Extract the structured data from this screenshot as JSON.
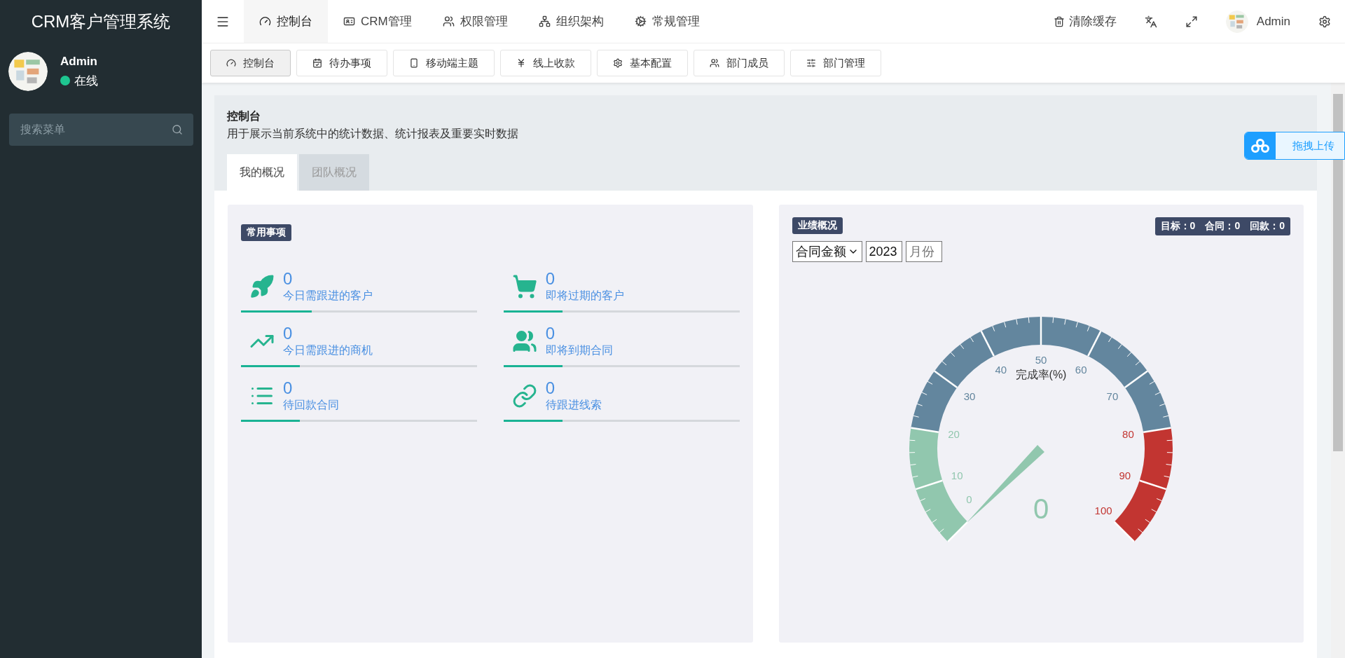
{
  "sidebar": {
    "title": "CRM客户管理系统",
    "user": {
      "name": "Admin",
      "status": "在线",
      "online": true
    },
    "search": {
      "placeholder": "搜索菜单"
    }
  },
  "top_nav": {
    "items": [
      {
        "label": "控制台",
        "selected": true
      },
      {
        "label": "CRM管理",
        "selected": false
      },
      {
        "label": "权限管理",
        "selected": false
      },
      {
        "label": "组织架构",
        "selected": false
      },
      {
        "label": "常规管理",
        "selected": false
      }
    ],
    "actions": [
      {
        "kind": "clear-cache",
        "label": "清除缓存"
      },
      {
        "kind": "translate"
      },
      {
        "kind": "fullscreen"
      },
      {
        "kind": "user",
        "label": "Admin"
      },
      {
        "kind": "settings"
      }
    ]
  },
  "page_tabs": [
    {
      "label": "控制台",
      "selected": true
    },
    {
      "label": "待办事项",
      "selected": false
    },
    {
      "label": "移动端主题",
      "selected": false
    },
    {
      "label": "线上收款",
      "selected": false
    },
    {
      "label": "基本配置",
      "selected": false
    },
    {
      "label": "部门成员",
      "selected": false
    },
    {
      "label": "部门管理",
      "selected": false
    }
  ],
  "header": {
    "title": "控制台",
    "subtitle": "用于展示当前系统中的统计数据、统计报表及重要实时数据"
  },
  "view_tabs": [
    {
      "label": "我的概况",
      "selected": true
    },
    {
      "label": "团队概况",
      "selected": false
    }
  ],
  "common": {
    "badge": "常用事项",
    "items": [
      {
        "count": "0",
        "label": "今日需跟进的客户",
        "level": 0.3
      },
      {
        "count": "0",
        "label": "即将过期的客户",
        "level": 0.25
      },
      {
        "count": "0",
        "label": "今日需跟进的商机",
        "level": 0.25
      },
      {
        "count": "0",
        "label": "即将到期合同",
        "level": 0.25
      },
      {
        "count": "0",
        "label": "待回款合同",
        "level": 0.25
      },
      {
        "count": "0",
        "label": "待跟进线索",
        "level": 0.25
      }
    ]
  },
  "performance": {
    "badge": "业绩概况",
    "stats": [
      "目标：0",
      "合同：0",
      "回款：0"
    ],
    "metric": {
      "value": "合同金额"
    },
    "year": {
      "value": "2023"
    },
    "month": {
      "placeholder": "月份"
    },
    "gauge": {
      "title": "完成率(%)",
      "value": "0",
      "labels": [
        "0",
        "10",
        "20",
        "30",
        "40",
        "50",
        "60",
        "70",
        "80",
        "90",
        "100"
      ]
    }
  },
  "upload_button": {
    "label": "拖拽上传"
  }
}
